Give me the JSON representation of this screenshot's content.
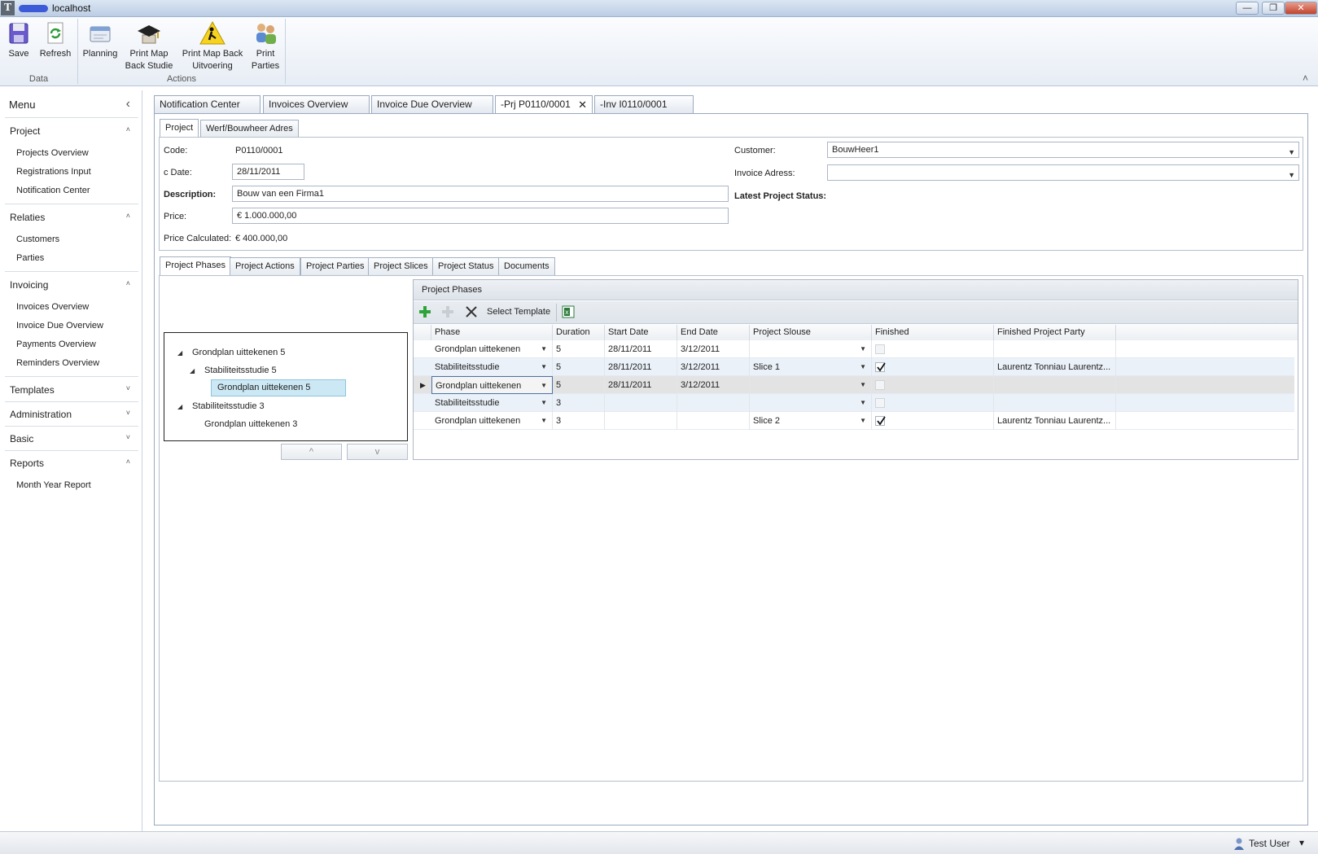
{
  "window": {
    "title": "localhost",
    "logo_letter": "T",
    "min_glyph": "—",
    "max_glyph": "❐",
    "close_glyph": "✕"
  },
  "ribbon": {
    "buttons": [
      {
        "label": "Save",
        "icon": "save-icon"
      },
      {
        "label": "Refresh",
        "icon": "refresh-icon"
      },
      {
        "label": "Planning",
        "icon": "planning-icon"
      },
      {
        "label_line1": "Print Map",
        "label_line2": "Back Studie",
        "icon": "graduation-cap-icon"
      },
      {
        "label_line1": "Print Map Back",
        "label_line2": "Uitvoering",
        "icon": "construction-sign-icon"
      },
      {
        "label_line1": "Print",
        "label_line2": "Parties",
        "icon": "people-icon"
      }
    ],
    "groups": [
      "Data",
      "Actions"
    ],
    "collapse_glyph": "˄"
  },
  "sidebar": {
    "title": "Menu",
    "collapse_glyph": "‹",
    "sections": [
      {
        "label": "Project",
        "expanded": true,
        "items": [
          "Projects Overview",
          "Registrations Input",
          "Notification Center"
        ]
      },
      {
        "label": "Relaties",
        "expanded": true,
        "items": [
          "Customers",
          "Parties"
        ]
      },
      {
        "label": "Invoicing",
        "expanded": true,
        "items": [
          "Invoices Overview",
          "Invoice Due Overview",
          "Payments Overview",
          "Reminders Overview"
        ]
      },
      {
        "label": "Templates",
        "expanded": false,
        "items": []
      },
      {
        "label": "Administration",
        "expanded": false,
        "items": []
      },
      {
        "label": "Basic",
        "expanded": false,
        "items": []
      },
      {
        "label": "Reports",
        "expanded": true,
        "items": [
          "Month Year Report"
        ]
      }
    ],
    "expanded_glyph": "˄",
    "collapsed_glyph": "˅"
  },
  "doc_tabs": [
    {
      "label": "Notification Center",
      "active": false
    },
    {
      "label": "Invoices Overview",
      "active": false
    },
    {
      "label": "Invoice Due Overview",
      "active": false
    },
    {
      "label": "-Prj P0110/0001",
      "active": true,
      "close_glyph": "✕"
    },
    {
      "label": "-Inv I0110/0001",
      "active": false
    }
  ],
  "project_tabs": [
    {
      "label": "Project",
      "active": true
    },
    {
      "label": "Werf/Bouwheer Adres",
      "active": false
    }
  ],
  "form": {
    "code_label": "Code:",
    "code_value": "P0110/0001",
    "cdate_label": "c Date:",
    "cdate_value": "28/11/2011",
    "description_label": "Description:",
    "description_value": "Bouw van een Firma1",
    "price_label": "Price:",
    "price_value": "€ 1.000.000,00",
    "price_calc_label": "Price Calculated:",
    "price_calc_value": "€ 400.000,00",
    "customer_label": "Customer:",
    "customer_value": "BouwHeer1",
    "invoice_address_label": "Invoice Adress:",
    "invoice_address_value": "",
    "latest_status_label": "Latest Project Status:"
  },
  "detail_tabs": [
    {
      "label": "Project Phases",
      "active": true
    },
    {
      "label": "Project Actions",
      "active": false
    },
    {
      "label": "Project Parties",
      "active": false
    },
    {
      "label": "Project Slices",
      "active": false
    },
    {
      "label": "Project Status",
      "active": false
    },
    {
      "label": "Documents",
      "active": false
    }
  ],
  "tree": {
    "nodes": [
      {
        "label": "Grondplan uittekenen 5",
        "level": 0,
        "expander": "◢"
      },
      {
        "label": "Stabiliteitsstudie 5",
        "level": 1,
        "expander": "◢"
      },
      {
        "label": "Grondplan uittekenen 5",
        "level": 2,
        "expander": "",
        "selected": true
      },
      {
        "label": "Stabiliteitsstudie 3",
        "level": 0,
        "expander": "◢"
      },
      {
        "label": "Grondplan uittekenen 3",
        "level": 1,
        "expander": ""
      }
    ],
    "up_label": "^",
    "down_label": "v"
  },
  "phases": {
    "title": "Project Phases",
    "toolbar": {
      "select_template_label": "Select Template"
    },
    "columns": [
      "Phase",
      "Duration",
      "Start Date",
      "End Date",
      "Project Slouse",
      "Finished",
      "Finished Project Party"
    ],
    "rows": [
      {
        "phase": "Grondplan uittekenen",
        "duration": "5",
        "start": "28/11/2011",
        "end": "3/12/2011",
        "slice": "",
        "finished": false,
        "party": ""
      },
      {
        "phase": "Stabiliteitsstudie",
        "duration": "5",
        "start": "28/11/2011",
        "end": "3/12/2011",
        "slice": "Slice 1",
        "finished": true,
        "party": "Laurentz Tonniau Laurentz..."
      },
      {
        "phase": "Grondplan uittekenen",
        "duration": "5",
        "start": "28/11/2011",
        "end": "3/12/2011",
        "slice": "",
        "finished": false,
        "party": "",
        "current": true
      },
      {
        "phase": "Stabiliteitsstudie",
        "duration": "3",
        "start": "",
        "end": "",
        "slice": "",
        "finished": false,
        "party": ""
      },
      {
        "phase": "Grondplan uittekenen",
        "duration": "3",
        "start": "",
        "end": "",
        "slice": "Slice 2",
        "finished": true,
        "party": "Laurentz Tonniau Laurentz..."
      }
    ]
  },
  "status": {
    "user": "Test User",
    "dropdown_glyph": "▾"
  },
  "colors": {
    "accent": "#cce8f4",
    "row_alt": "#eaf1f8",
    "row_current": "#e3e3e3"
  }
}
